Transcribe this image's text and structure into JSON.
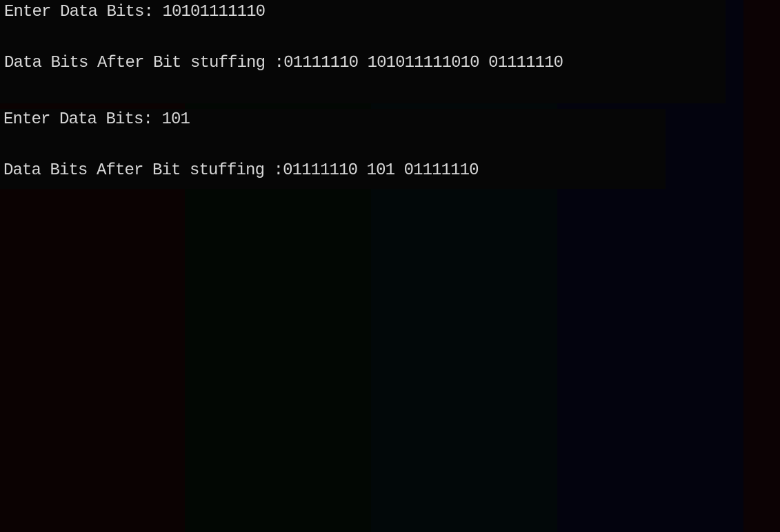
{
  "console": {
    "lines": [
      {
        "prompt": "Enter Data Bits: ",
        "value": "10101111110"
      },
      {
        "prompt": "Data Bits After Bit stuffing :",
        "value": "01111110 101011111010 01111110"
      },
      {
        "prompt": "Enter Data Bits: ",
        "value": "101"
      },
      {
        "prompt": "Data Bits After Bit stuffing :",
        "value": "01111110 101 01111110"
      }
    ]
  },
  "colors": {
    "text": "#d7d7d7",
    "background": "#000000"
  }
}
